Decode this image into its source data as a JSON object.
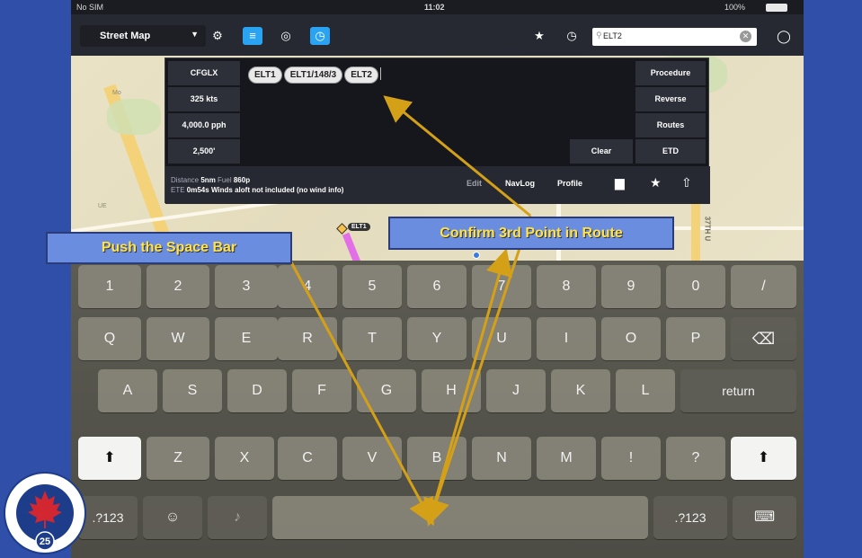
{
  "status": {
    "carrier": "No SIM",
    "time": "11:02",
    "battery": "100%"
  },
  "toolbar": {
    "map_mode": "Street Map",
    "search": {
      "value": "ELT2"
    }
  },
  "map_labels": [
    "Mo",
    "UE",
    "37TH U",
    "ELT1",
    "ELT1"
  ],
  "panel": {
    "left": [
      "CFGLX",
      "325 kts",
      "4,000.0 pph",
      "2,500'"
    ],
    "right": [
      "Procedure",
      "Reverse",
      "Routes",
      "ETD"
    ],
    "route_chips": [
      "ELT1",
      "ELT1/148/3",
      "ELT2"
    ],
    "clear": "Clear",
    "info": {
      "distance_label": "Distance",
      "distance": "5nm",
      "fuel_label": "Fuel",
      "fuel": "860p",
      "ete_label": "ETE",
      "ete": "0m54s",
      "winds": "Winds aloft not included (no wind info)"
    },
    "tabs": [
      "Edit",
      "NavLog",
      "Profile"
    ]
  },
  "keyboard": {
    "row1": [
      "1",
      "2",
      "3",
      "4",
      "5",
      "6",
      "7",
      "8",
      "9",
      "0",
      "/"
    ],
    "row2": [
      "Q",
      "W",
      "E",
      "R",
      "T",
      "Y",
      "U",
      "I",
      "O",
      "P"
    ],
    "row3": [
      "A",
      "S",
      "D",
      "F",
      "G",
      "H",
      "J",
      "K",
      "L"
    ],
    "row3_return": "return",
    "row4": [
      "Z",
      "X",
      "C",
      "V",
      "B",
      "N",
      "M",
      "!",
      "?"
    ],
    "row5_left": ".?123",
    "row5_right": ".?123"
  },
  "annotations": {
    "left": "Push the Space Bar",
    "right": "Confirm 3rd Point in Route"
  },
  "logo": {
    "top_text": "CIVIL AIR SEARCH AND RESCUE",
    "center": "CASARA",
    "bottom_text": "ASSOCIATION",
    "years_left": "1986",
    "years_right": "2011",
    "number": "25"
  },
  "colors": {
    "accent": "#2aa3f2",
    "annotation_text": "#ffe24a",
    "annotation_bg": "#6b8de0",
    "slide_bg": "#2f4fa8",
    "arrow": "#d4a017"
  }
}
